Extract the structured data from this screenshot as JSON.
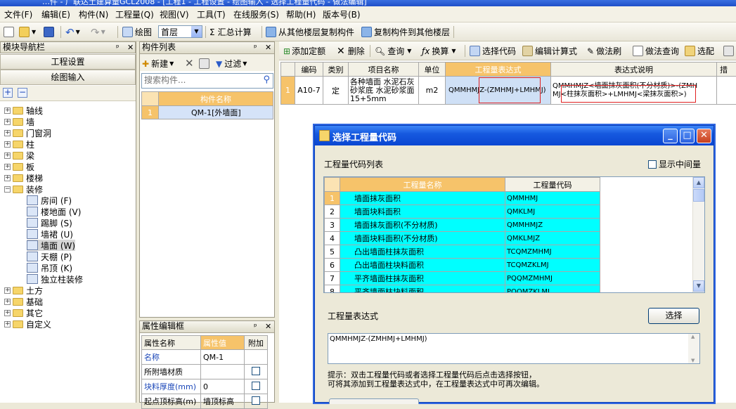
{
  "window": {
    "title_fragment": "…件 - 广联达土建算量GCL2008 - [工程1 - 工程设置 - 绘图输入 - 选择工程量代码 - 做法编辑]"
  },
  "menu": [
    "文件(F)",
    "编辑(E)",
    "构件(N)",
    "工程量(Q)",
    "视图(V)",
    "工具(T)",
    "在线服务(S)",
    "帮助(H)",
    "版本号(B)"
  ],
  "toolbar1": {
    "draw": "绘图",
    "floor": "首层",
    "sum_calc": "汇总计算",
    "copy_from_other": "从其他楼层复制构件",
    "copy_to_other": "复制构件到其他楼层"
  },
  "nav": {
    "title": "模块导航栏",
    "btn_settings": "工程设置",
    "btn_draw": "绘图输入",
    "tree": [
      {
        "label": "轴线",
        "expanded": false
      },
      {
        "label": "墙",
        "expanded": false
      },
      {
        "label": "门窗洞",
        "expanded": false
      },
      {
        "label": "柱",
        "expanded": false
      },
      {
        "label": "梁",
        "expanded": false
      },
      {
        "label": "板",
        "expanded": false
      },
      {
        "label": "楼梯",
        "expanded": false
      },
      {
        "label": "装修",
        "expanded": true
      }
    ],
    "decor_children": [
      "房间 (F)",
      "楼地面 (V)",
      "踢脚 (S)",
      "墙裙 (U)",
      "墙面 (W)",
      "天棚 (P)",
      "吊顶 (K)",
      "独立柱装修"
    ],
    "tree_after": [
      "土方",
      "基础",
      "其它",
      "自定义"
    ]
  },
  "comp": {
    "title": "构件列表",
    "new": "新建",
    "filter": "过滤",
    "search_placeholder": "搜索构件...",
    "col_name": "构件名称",
    "rows": [
      {
        "idx": "1",
        "name": "QM-1[外墙面]"
      }
    ]
  },
  "prop": {
    "title": "属性编辑框",
    "col_name": "属性名称",
    "col_value": "属性值",
    "col_add": "附加",
    "rows": [
      {
        "name": "名称",
        "value": "QM-1"
      },
      {
        "name": "所附墙材质",
        "value": ""
      },
      {
        "name": "块料厚度(mm)",
        "value": "0"
      },
      {
        "name": "起点顶标高(m)",
        "value": "墙顶标高"
      }
    ]
  },
  "main_toolbar": {
    "add_quota": "添加定额",
    "delete": "删除",
    "query": "查询",
    "convert": "换算",
    "select_code": "选择代码",
    "edit_formula": "编辑计算式",
    "brush": "做法刷",
    "query_method": "做法查询",
    "match": "选配"
  },
  "grid": {
    "headers": [
      "编码",
      "类别",
      "项目名称",
      "单位",
      "工程量表达式",
      "表达式说明",
      "措"
    ],
    "row": {
      "idx": "1",
      "code": "A10-7",
      "type": "定",
      "name": "各种墙面 水泥石灰砂浆底 水泥砂浆面 15+5mm",
      "unit": "m2",
      "expr_a": "QMMHMJZ-",
      "expr_b": "(ZMHMJ+LMHMJ)",
      "desc_a": "QMMHMJZ<墙面抹灰面积(不分材质)>-(ZMH",
      "desc_b": "MJ<柱抹灰面积>+LMHMJ<梁抹灰面积>)"
    }
  },
  "dialog": {
    "title": "选择工程量代码",
    "list_label": "工程量代码列表",
    "show_mid": "显示中间量",
    "col_name": "工程量名称",
    "col_code": "工程量代码",
    "rows": [
      {
        "idx": "1",
        "name": "墙面抹灰面积",
        "code": "QMMHMJ"
      },
      {
        "idx": "2",
        "name": "墙面块料面积",
        "code": "QMKLMJ"
      },
      {
        "idx": "3",
        "name": "墙面抹灰面积(不分材质)",
        "code": "QMMHMJZ"
      },
      {
        "idx": "4",
        "name": "墙面块料面积(不分材质)",
        "code": "QMKLMJZ"
      },
      {
        "idx": "5",
        "name": "凸出墙面柱抹灰面积",
        "code": "TCQMZMHMJ"
      },
      {
        "idx": "6",
        "name": "凸出墙面柱块料面积",
        "code": "TCQMZKLMJ"
      },
      {
        "idx": "7",
        "name": "平齐墙面柱抹灰面积",
        "code": "PQQMZMHMJ"
      },
      {
        "idx": "8",
        "name": "平齐墙面柱块料面积",
        "code": "PQQMZKLMJ"
      }
    ],
    "expr_label": "工程量表达式",
    "select_btn": "选择",
    "expr_value": "QMMHMJZ-(ZMHMJ+LMHMJ)",
    "hint1": "提示：双击工程量代码或者选择工程量代码后点击选择按钮，",
    "hint2": "可将其添加到工程量表达式中，在工程量表达式中可再次编辑。"
  },
  "colors": {
    "accent_cyan": "#00ffff",
    "header_orange": "#f6c36a",
    "xp_blue": "#0a46d2",
    "red_box": "#e02020"
  }
}
